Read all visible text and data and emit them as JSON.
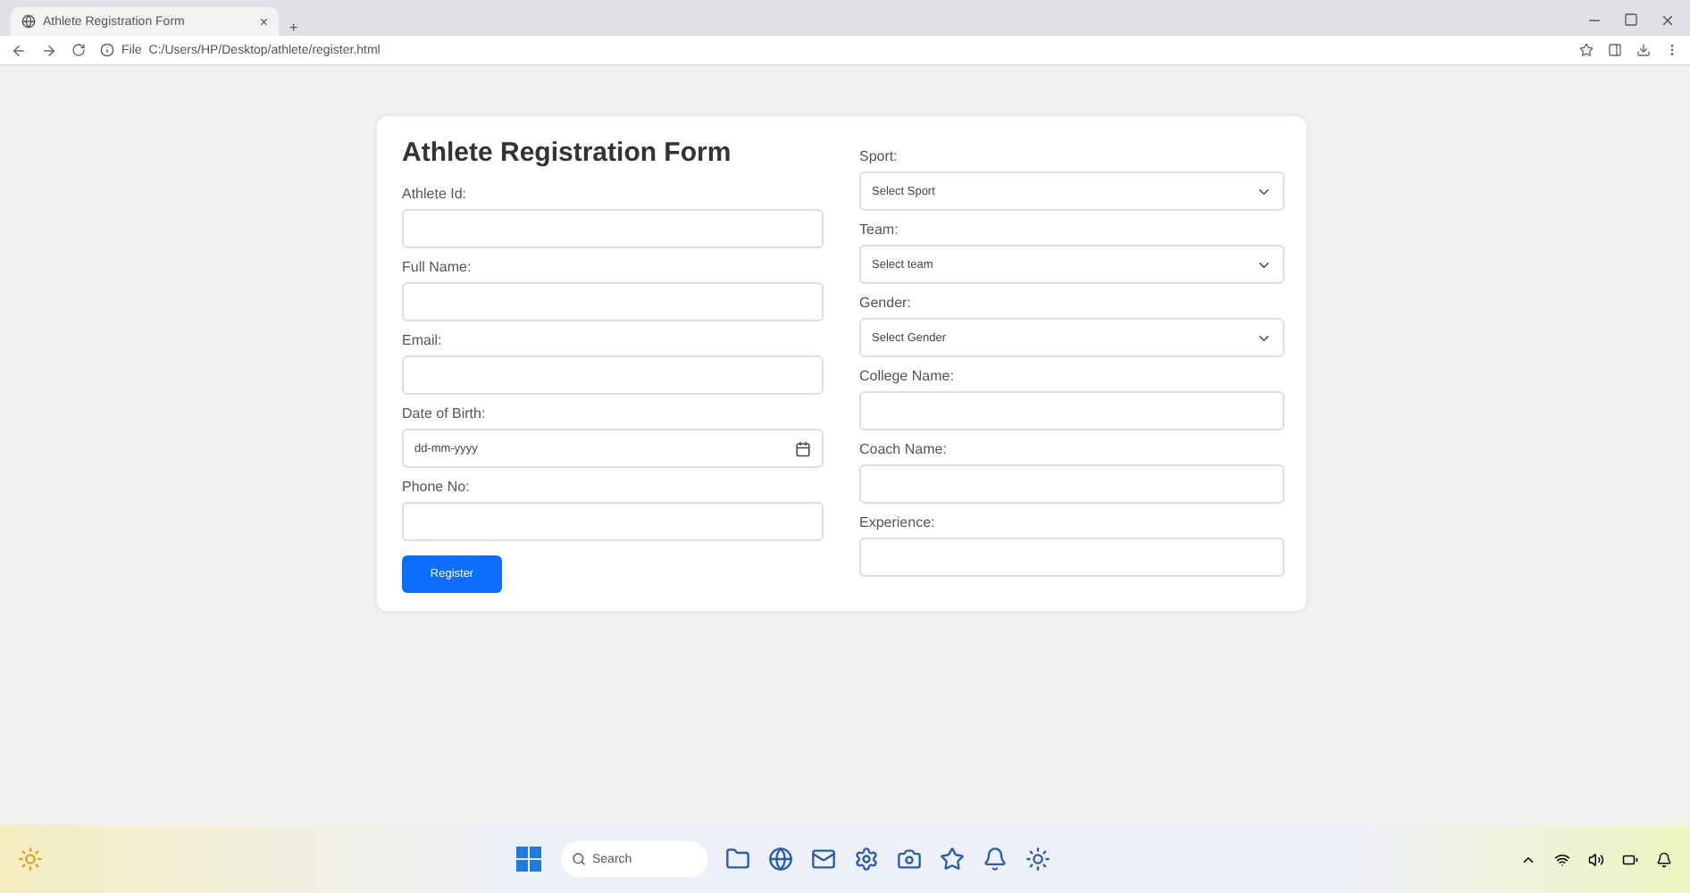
{
  "browser": {
    "tab_title": "Athlete Registration Form",
    "tab_close": "×",
    "new_tab": "+",
    "address_scheme": "File",
    "address": "C:/Users/HP/Desktop/athlete/register.html"
  },
  "form": {
    "title": "Athlete Registration Form",
    "left_fields": [
      {
        "label": "Athlete Id:",
        "kind": "text"
      },
      {
        "label": "Full Name:",
        "kind": "text"
      },
      {
        "label": "Email:",
        "kind": "text"
      },
      {
        "label": "Date of Birth:",
        "kind": "date",
        "placeholder": "dd-mm-yyyy"
      },
      {
        "label": "Phone No:",
        "kind": "text"
      }
    ],
    "submit": "Register",
    "right_fields": [
      {
        "label": "Sport:",
        "kind": "select",
        "placeholder": "Select Sport"
      },
      {
        "label": "Team:",
        "kind": "select",
        "placeholder": "Select team"
      },
      {
        "label": "Gender:",
        "kind": "select",
        "placeholder": "Select Gender"
      },
      {
        "label": "College Name:",
        "kind": "text"
      },
      {
        "label": "Coach Name:",
        "kind": "text"
      },
      {
        "label": "Experience:",
        "kind": "text"
      }
    ]
  },
  "taskbar": {
    "search": "Search"
  }
}
